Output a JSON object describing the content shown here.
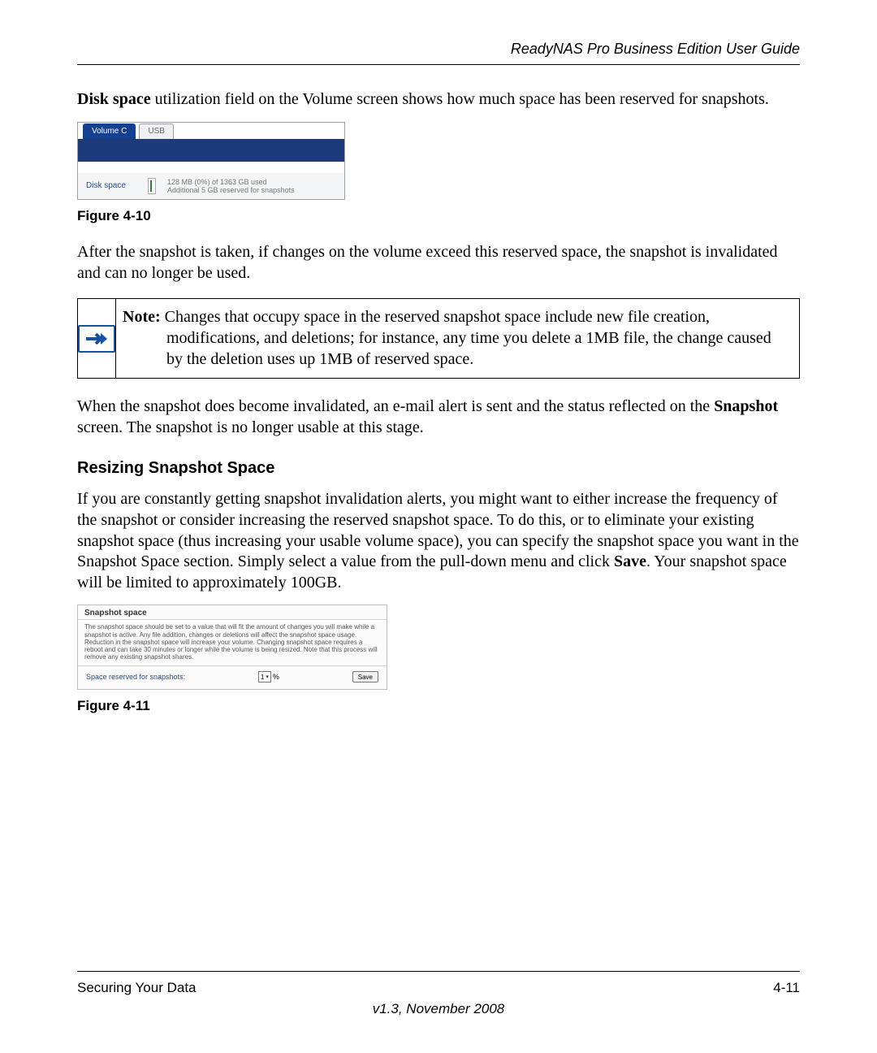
{
  "header": {
    "title": "ReadyNAS Pro Business Edition User Guide"
  },
  "intro": {
    "disk_space_bold": "Disk space",
    "disk_space_rest": " utilization field on the Volume screen shows how much space has been reserved for snapshots."
  },
  "fig10": {
    "tab_active": "Volume C",
    "tab_inactive": "USB",
    "row_label": "Disk space",
    "usage_line1": "128 MB (0%) of 1363 GB used",
    "usage_line2": "Additional 5 GB reserved for snapshots",
    "caption": "Figure 4-10"
  },
  "after_snapshot": "After the snapshot is taken, if changes on the volume exceed this reserved space, the snapshot is invalidated and can no longer be used.",
  "note": {
    "label": "Note:",
    "text": " Changes that occupy space in the reserved snapshot space include new file creation, modifications, and deletions; for instance, any time you delete a 1MB file, the change caused by the deletion uses up 1MB of reserved space."
  },
  "invalidated": {
    "pre": "When the snapshot does become invalidated, an e-mail alert is sent and the status reflected on the ",
    "bold": "Snapshot",
    "post": " screen. The snapshot is no longer usable at this stage."
  },
  "resize": {
    "heading": "Resizing Snapshot Space",
    "para_pre": "If you are constantly getting snapshot invalidation alerts, you might want to either increase the frequency of the snapshot or consider increasing the reserved snapshot space. To do this, or to eliminate your existing snapshot space (thus increasing your usable volume space), you can specify the snapshot space you want in the Snapshot Space section. Simply select a value from the pull-down menu and click ",
    "para_bold": "Save",
    "para_post": ". Your snapshot space will be limited to approximately 100GB."
  },
  "fig11": {
    "panel_title": "Snapshot space",
    "panel_text": "The snapshot space should be set to a value that will fit the amount of changes you will make while a snapshot is active. Any file addition, changes or deletions will affect the snapshot space usage. Reduction in the snapshot space will increase your volume. Changing snapshot space requires a reboot and can take 30 minutes or longer while the volume is being resized. Note that this process will remove any existing snapshot shares.",
    "row_label": "Space reserved for snapshots:",
    "select_value": "1",
    "percent": "%",
    "save_label": "Save",
    "caption": "Figure 4-11"
  },
  "footer": {
    "section": "Securing Your Data",
    "page": "4-11",
    "version": "v1.3, November 2008"
  }
}
